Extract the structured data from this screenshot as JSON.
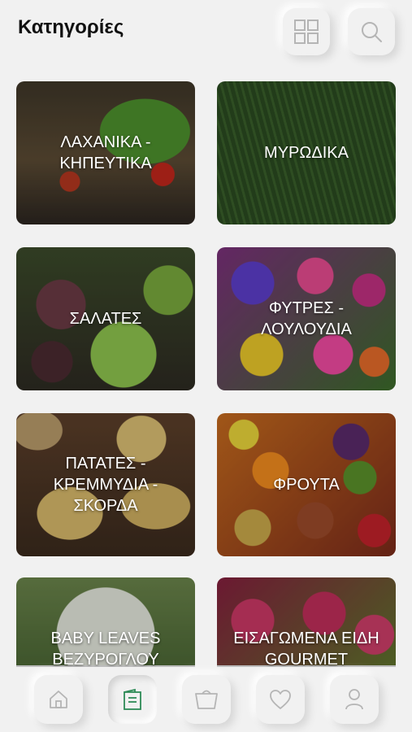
{
  "header": {
    "title": "Κατηγορίες",
    "grid_icon": "grid-icon",
    "search_icon": "search-icon"
  },
  "categories": [
    {
      "label": "ΛΑΧΑΝΙΚΑ -\nΚΗΠΕΥΤΙΚΑ"
    },
    {
      "label": "ΜΥΡΩΔΙΚΑ"
    },
    {
      "label": "ΣΑΛΑΤΕΣ"
    },
    {
      "label": "ΦΥΤΡΕΣ -\nΛΟΥΛΟΥΔΙΑ"
    },
    {
      "label": "ΠΑΤΑΤΕΣ -\nΚΡΕΜΜΥΔΙΑ -\nΣΚΟΡΔΑ"
    },
    {
      "label": "ΦΡΟΥΤΑ"
    },
    {
      "label": "BABY LEAVES\nΒΕΖΥΡΟΓΛΟΥ"
    },
    {
      "label": "ΕΙΣΑΓΩΜΕΝΑ ΕΙΔΗ\nGOURMET"
    }
  ],
  "bottom_nav": {
    "items": [
      {
        "icon": "home-icon"
      },
      {
        "icon": "catalog-icon",
        "active": true
      },
      {
        "icon": "basket-icon"
      },
      {
        "icon": "heart-icon"
      },
      {
        "icon": "user-icon"
      }
    ],
    "active_color": "#2e8b57"
  }
}
